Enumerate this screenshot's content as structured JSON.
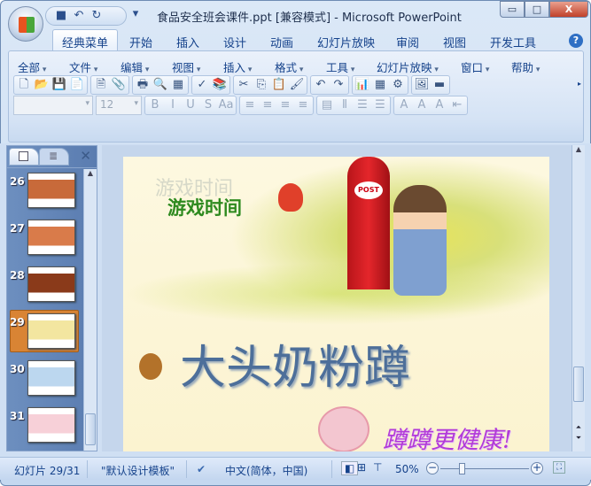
{
  "window": {
    "title": "食品安全班会课件.ppt [兼容模式] - Microsoft PowerPoint",
    "min": "▭",
    "max": "□",
    "close": "X"
  },
  "quick_access": [
    {
      "icon": "save-icon",
      "g": "■"
    },
    {
      "icon": "undo-icon",
      "g": "↶"
    },
    {
      "icon": "redo-icon",
      "g": "↻"
    },
    {
      "icon": "customize-icon",
      "g": "▾"
    }
  ],
  "tabs": [
    "经典菜单",
    "开始",
    "插入",
    "设计",
    "动画",
    "幻灯片放映",
    "审阅",
    "视图",
    "开发工具"
  ],
  "help": "?",
  "menus": [
    "全部",
    "文件",
    "编辑",
    "视图",
    "插入",
    "格式",
    "工具",
    "幻灯片放映",
    "窗口",
    "帮助"
  ],
  "toolbar": {
    "font_name": "",
    "font_size": "12",
    "row1": [
      [
        "🗋",
        "📂",
        "💾",
        "📄"
      ],
      [
        "🗎",
        "📎"
      ],
      [
        "🖶",
        "🔍",
        "▦"
      ],
      [
        "✓",
        "📚"
      ],
      [
        "✂",
        "⎘",
        "📋",
        "🖌"
      ],
      [
        "↶",
        "↷"
      ],
      [
        "📊",
        "▦",
        "⚙"
      ],
      [
        "🖼",
        "▬"
      ]
    ],
    "row2": [
      [
        "B",
        "I",
        "U",
        "S",
        "Aa"
      ],
      [
        "≡",
        "≡",
        "≡",
        "≡"
      ],
      [
        "▤",
        "⫴",
        "☰",
        "☰"
      ],
      [
        "A",
        "A",
        "A",
        "⇤"
      ]
    ]
  },
  "slides_pane": {
    "thumbnails": [
      {
        "n": "26"
      },
      {
        "n": "27"
      },
      {
        "n": "28"
      },
      {
        "n": "29",
        "selected": true
      },
      {
        "n": "30"
      },
      {
        "n": "31"
      }
    ],
    "close": "✕"
  },
  "slide": {
    "ghost": "游戏时间",
    "heading": "游戏时间",
    "title": "大头奶粉蹲",
    "subtitle": "蹲蹲更健康!",
    "post": "POST"
  },
  "status": {
    "slide": "幻灯片 29/31",
    "theme": "\"默认设计模板\"",
    "language": "中文(简体，中国)",
    "zoom": "50%",
    "zoom_value": 50
  },
  "colors": {
    "accent": "#15428b",
    "heading": "#2e8a1f",
    "title": "#4d6f9a",
    "subtitle": "#b23ad8",
    "selected": "#d98434"
  }
}
